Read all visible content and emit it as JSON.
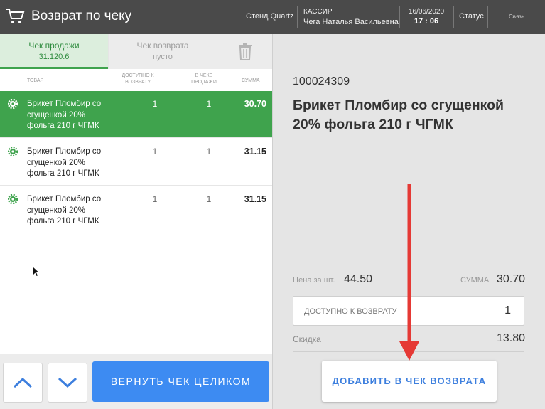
{
  "header": {
    "title": "Возврат по чеку",
    "stand": "Стенд Quartz",
    "cashier_role": "КАССИР",
    "cashier_name": "Чега Наталья Васильевна",
    "date": "16/06/2020",
    "time": "17 : 06",
    "status": "Статус",
    "link": "Связь",
    "cart_icon": "cart-icon"
  },
  "tabs": {
    "sale_label": "Чек продажи",
    "sale_value": "31.120.6",
    "return_label": "Чек возврата",
    "return_value": "пусто",
    "trash_icon": "trash-icon"
  },
  "columns": {
    "item": "ТОВАР",
    "available": "ДОСТУПНО К ВОЗВРАТУ",
    "in_receipt": "В ЧЕКЕ ПРОДАЖИ",
    "sum": "СУММА"
  },
  "rows": [
    {
      "name": "Брикет Пломбир со сгущенкой 20% фольга 210 г ЧГМК",
      "available": "1",
      "in_receipt": "1",
      "sum": "30.70",
      "selected": true
    },
    {
      "name": "Брикет Пломбир со сгущенкой 20% фольга 210 г ЧГМК",
      "available": "1",
      "in_receipt": "1",
      "sum": "31.15",
      "selected": false
    },
    {
      "name": "Брикет Пломбир со сгущенкой 20% фольга 210 г ЧГМК",
      "available": "1",
      "in_receipt": "1",
      "sum": "31.15",
      "selected": false
    }
  ],
  "buttons": {
    "up_icon": "chevron-up-icon",
    "down_icon": "chevron-down-icon",
    "return_all": "ВЕРНУТЬ ЧЕК ЦЕЛИКОМ",
    "add_to_return": "ДОБАВИТЬ В ЧЕК ВОЗВРАТА"
  },
  "detail": {
    "code": "100024309",
    "name": "Брикет Пломбир со сгущенкой 20% фольга 210 г ЧГМК",
    "price_label": "Цена за шт.",
    "price_value": "44.50",
    "sum_label": "СУММА",
    "sum_value": "30.70",
    "available_label": "ДОСТУПНО К ВОЗВРАТУ",
    "available_value": "1",
    "discount_label": "Скидка",
    "discount_value": "13.80"
  },
  "colors": {
    "header_bg": "#4a4a4a",
    "accent_green": "#3fa34d",
    "accent_blue": "#3d8bf2",
    "annotation_red": "#e53935"
  }
}
